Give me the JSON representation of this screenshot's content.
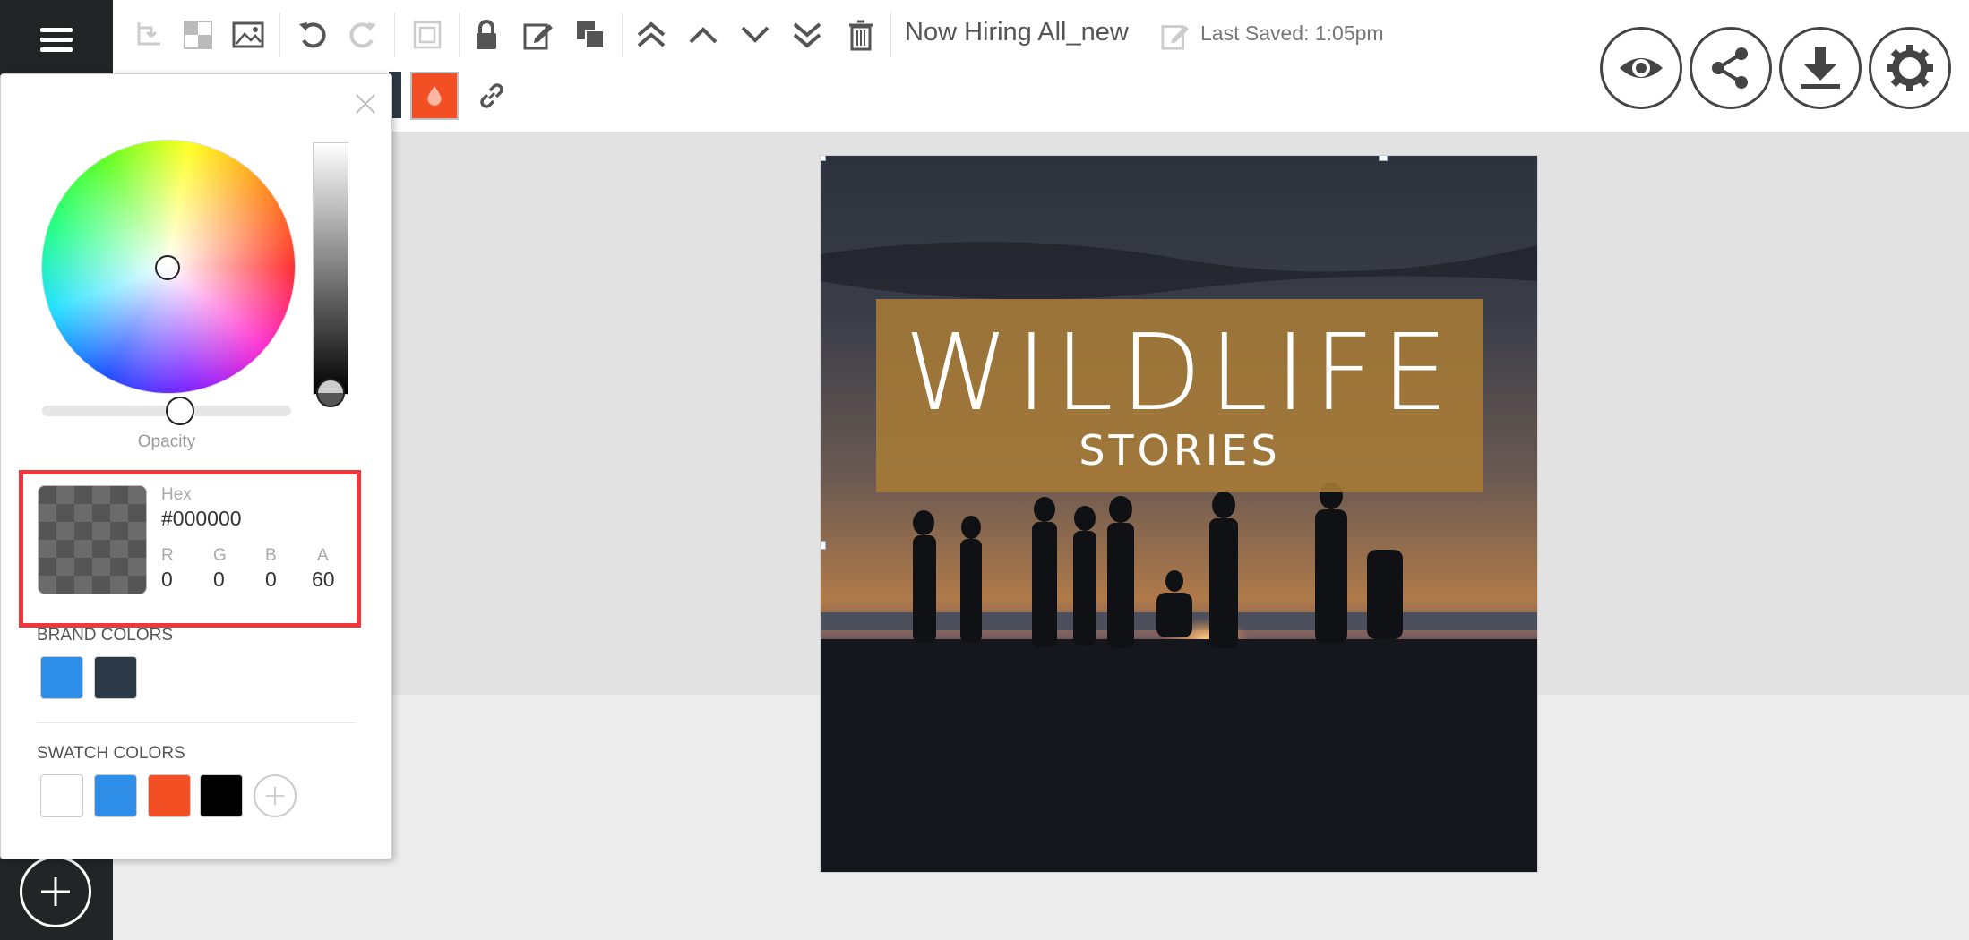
{
  "rail": {
    "menu_icon": "hamburger-menu-icon",
    "add_icon": "plus-icon"
  },
  "toolbar": {
    "icons": [
      "undo-crop-icon",
      "transparency-icon",
      "image-icon",
      "undo-icon",
      "redo-icon",
      "group-icon",
      "lock-icon",
      "edit-icon",
      "duplicate-icon",
      "bring-to-front-icon",
      "bring-forward-icon",
      "send-backward-icon",
      "send-to-back-icon",
      "trash-icon"
    ],
    "document_title": "Now Hiring All_new",
    "last_saved": "Last Saved: 1:05pm",
    "right_buttons": [
      "preview-eye-icon",
      "share-icon",
      "download-icon",
      "settings-gear-icon"
    ]
  },
  "subtoolbar": {
    "fill_color": "#f34f24",
    "icons": [
      "color-drop-icon",
      "link-icon"
    ]
  },
  "artboard": {
    "title": "WILDLIFE",
    "subtitle": "STORIES",
    "banner_color": "#aa7d37"
  },
  "picker": {
    "opacity_label": "Opacity",
    "opacity_value": 0.6,
    "hex_label": "Hex",
    "hex_value": "#000000",
    "rgba": [
      {
        "label": "R",
        "value": "0"
      },
      {
        "label": "G",
        "value": "0"
      },
      {
        "label": "B",
        "value": "0"
      },
      {
        "label": "A",
        "value": "60"
      }
    ],
    "brand_colors_label": "BRAND COLORS",
    "brand_colors": [
      "#2f8ee8",
      "#2c3a47"
    ],
    "swatch_colors_label": "SWATCH COLORS",
    "swatch_colors": [
      "#ffffff",
      "#2f8ee8",
      "#f34f24",
      "#000000"
    ],
    "highlight_color": "#f0373d"
  }
}
